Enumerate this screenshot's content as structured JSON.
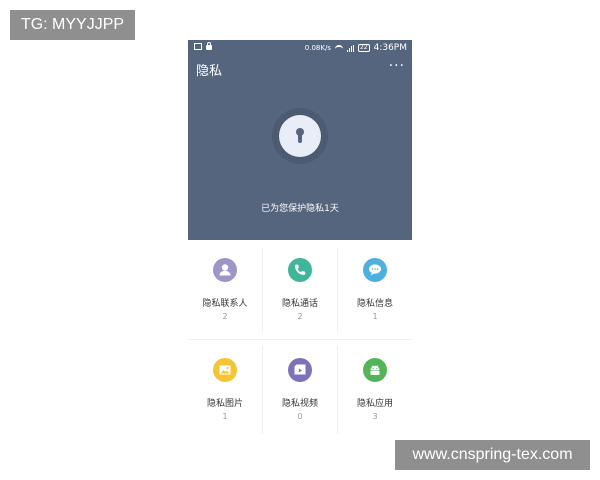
{
  "watermarks": {
    "top_left": "TG: MYYJJPP",
    "bottom_right": "www.cnspring-tex.com"
  },
  "status_bar": {
    "speed": "0.08K/s",
    "battery": "22",
    "time": "4:36PM"
  },
  "header": {
    "title": "隐私",
    "more": "···",
    "protect_text": "已为您保护隐私1天",
    "color": "#56657e"
  },
  "items": [
    {
      "label": "隐私联系人",
      "count": "2",
      "icon": "contact-icon",
      "color": "#9e96c8"
    },
    {
      "label": "隐私通话",
      "count": "2",
      "icon": "phone-icon",
      "color": "#3fb59a"
    },
    {
      "label": "隐私信息",
      "count": "1",
      "icon": "message-icon",
      "color": "#4fb0e0"
    },
    {
      "label": "隐私图片",
      "count": "1",
      "icon": "picture-icon",
      "color": "#f4c532"
    },
    {
      "label": "隐私视频",
      "count": "0",
      "icon": "video-icon",
      "color": "#7c72b8"
    },
    {
      "label": "隐私应用",
      "count": "3",
      "icon": "android-icon",
      "color": "#53b45a"
    }
  ]
}
